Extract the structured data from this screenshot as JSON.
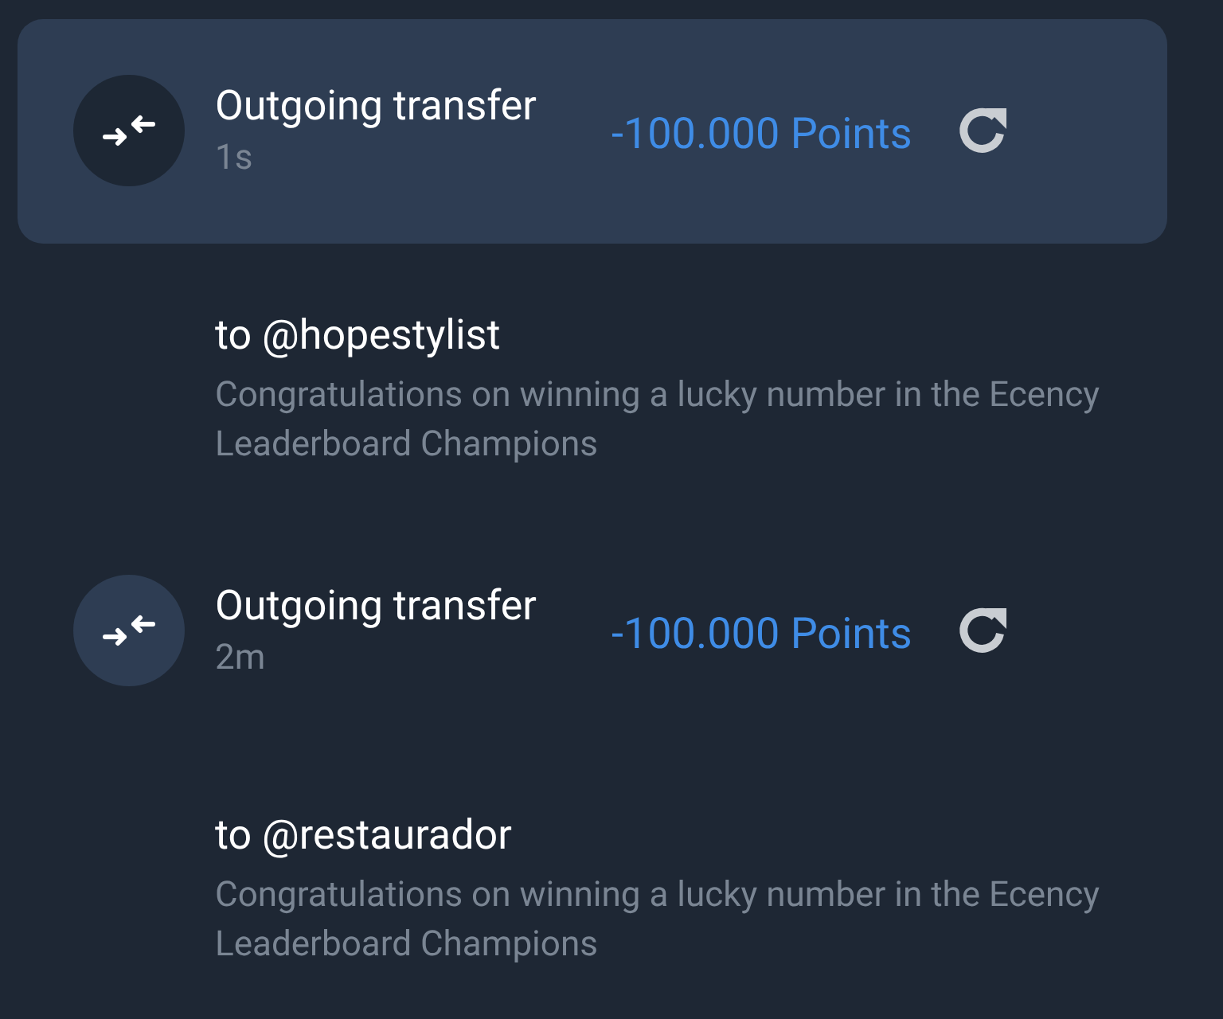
{
  "transactions": [
    {
      "title": "Outgoing transfer",
      "time": "1s",
      "amount": "-100.000 Points",
      "selected": true,
      "recipient": "to @hopestylist",
      "memo": "Congratulations on winning a lucky number in the Ecency Leaderboard Champions"
    },
    {
      "title": "Outgoing transfer",
      "time": "2m",
      "amount": "-100.000 Points",
      "selected": false,
      "recipient": "to @restaurador",
      "memo": "Congratulations on winning a lucky number in the Ecency Leaderboard Champions"
    }
  ]
}
